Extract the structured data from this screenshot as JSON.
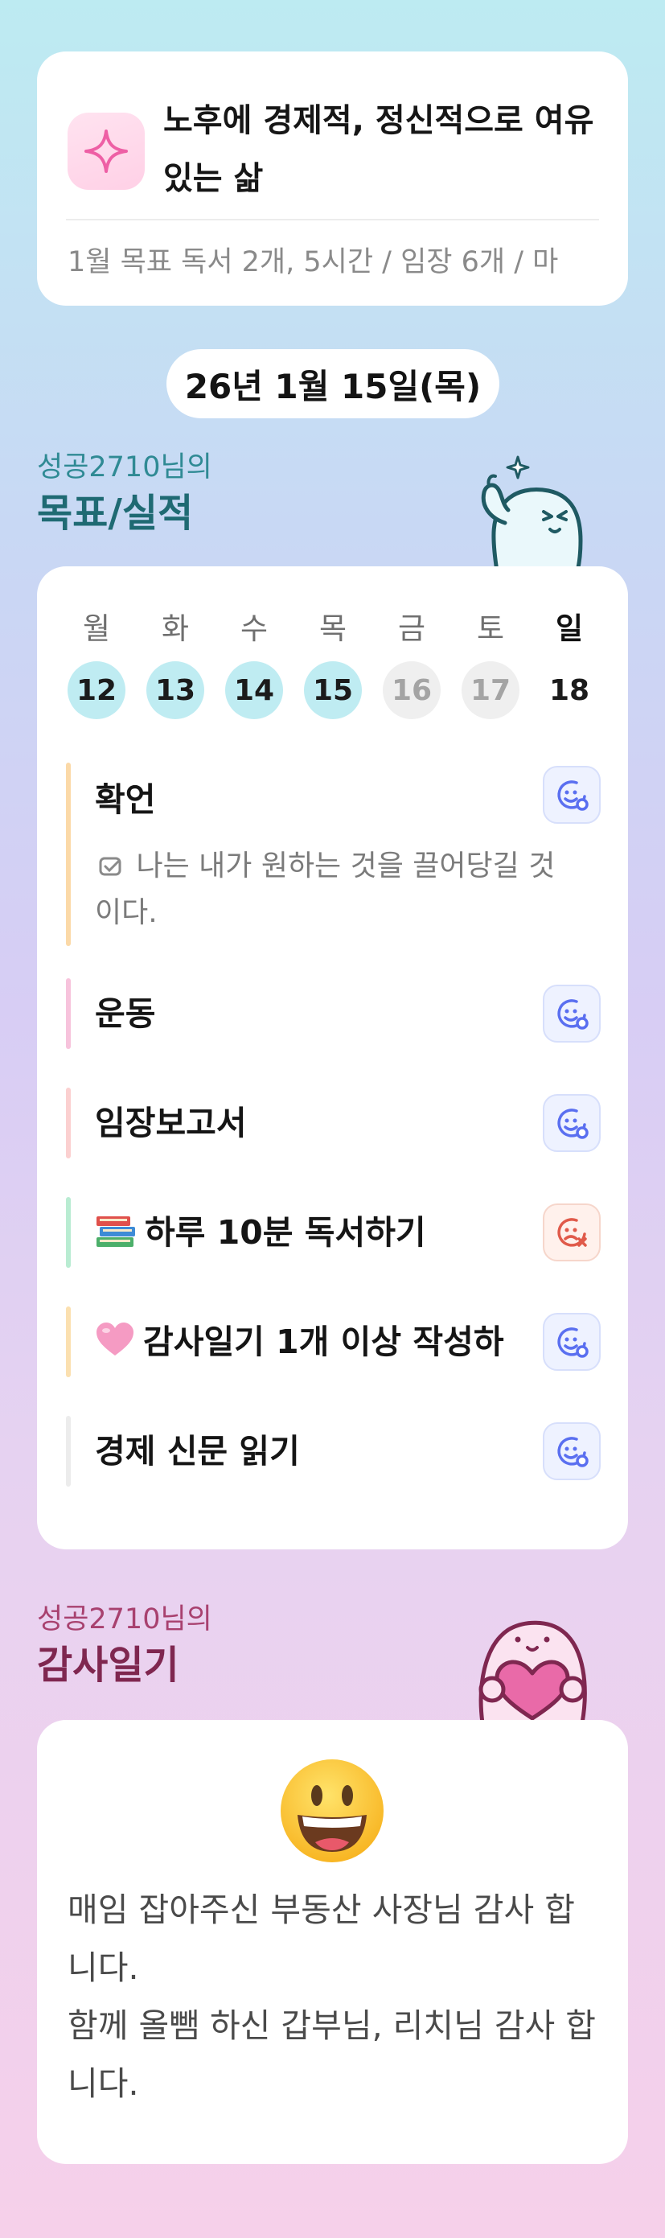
{
  "goal": {
    "title": "노후에 경제적, 정신적으로 여유있는 삶",
    "monthly": "1월 목표  독서 2개, 5시간 / 임장 6개 / 마",
    "icon": "sparkle-icon"
  },
  "date": "26년 1월 15일(목)",
  "performance": {
    "subtitle": "성공2710님의",
    "title": "목표/실적",
    "week": [
      {
        "label": "월",
        "num": "12",
        "state": "done"
      },
      {
        "label": "화",
        "num": "13",
        "state": "done"
      },
      {
        "label": "수",
        "num": "14",
        "state": "done"
      },
      {
        "label": "목",
        "num": "15",
        "state": "done"
      },
      {
        "label": "금",
        "num": "16",
        "state": "future"
      },
      {
        "label": "토",
        "num": "17",
        "state": "future"
      },
      {
        "label": "일",
        "num": "18",
        "state": "plain"
      }
    ],
    "tasks": [
      {
        "name": "확언",
        "note": "나는 내가 원하는 것을 끌어당길 것 이다.",
        "status": "done",
        "bar_color": "#fbd9a8"
      },
      {
        "name": "운동",
        "status": "done",
        "bar_color": "#f7c3dc"
      },
      {
        "name": "임장보고서",
        "status": "done",
        "bar_color": "#fbd0d0"
      },
      {
        "name": "하루 10분 독서하기",
        "emoji": "books",
        "status": "failed",
        "bar_color": "#b9ecd2"
      },
      {
        "name": "감사일기 1개 이상 작성하",
        "emoji": "pink-heart",
        "status": "done",
        "bar_color": "#fbe0b0"
      },
      {
        "name": "경제 신문 읽기",
        "status": "done",
        "bar_color": "#ececec"
      }
    ]
  },
  "diary": {
    "subtitle": "성공2710님의",
    "title": "감사일기",
    "emoji": "grinning-face",
    "line1": "매임 잡아주신 부동산 사장님 감사 합니다.",
    "line2": "함께 올뺌 하신 갑부님, 리치님 감사 합니다."
  },
  "colors": {
    "accent_teal": "#1f6a73",
    "accent_magenta": "#7f2750",
    "done_day": "#bfecf2",
    "status_ok": "#5a6ff0",
    "status_fail": "#e05a4a"
  }
}
